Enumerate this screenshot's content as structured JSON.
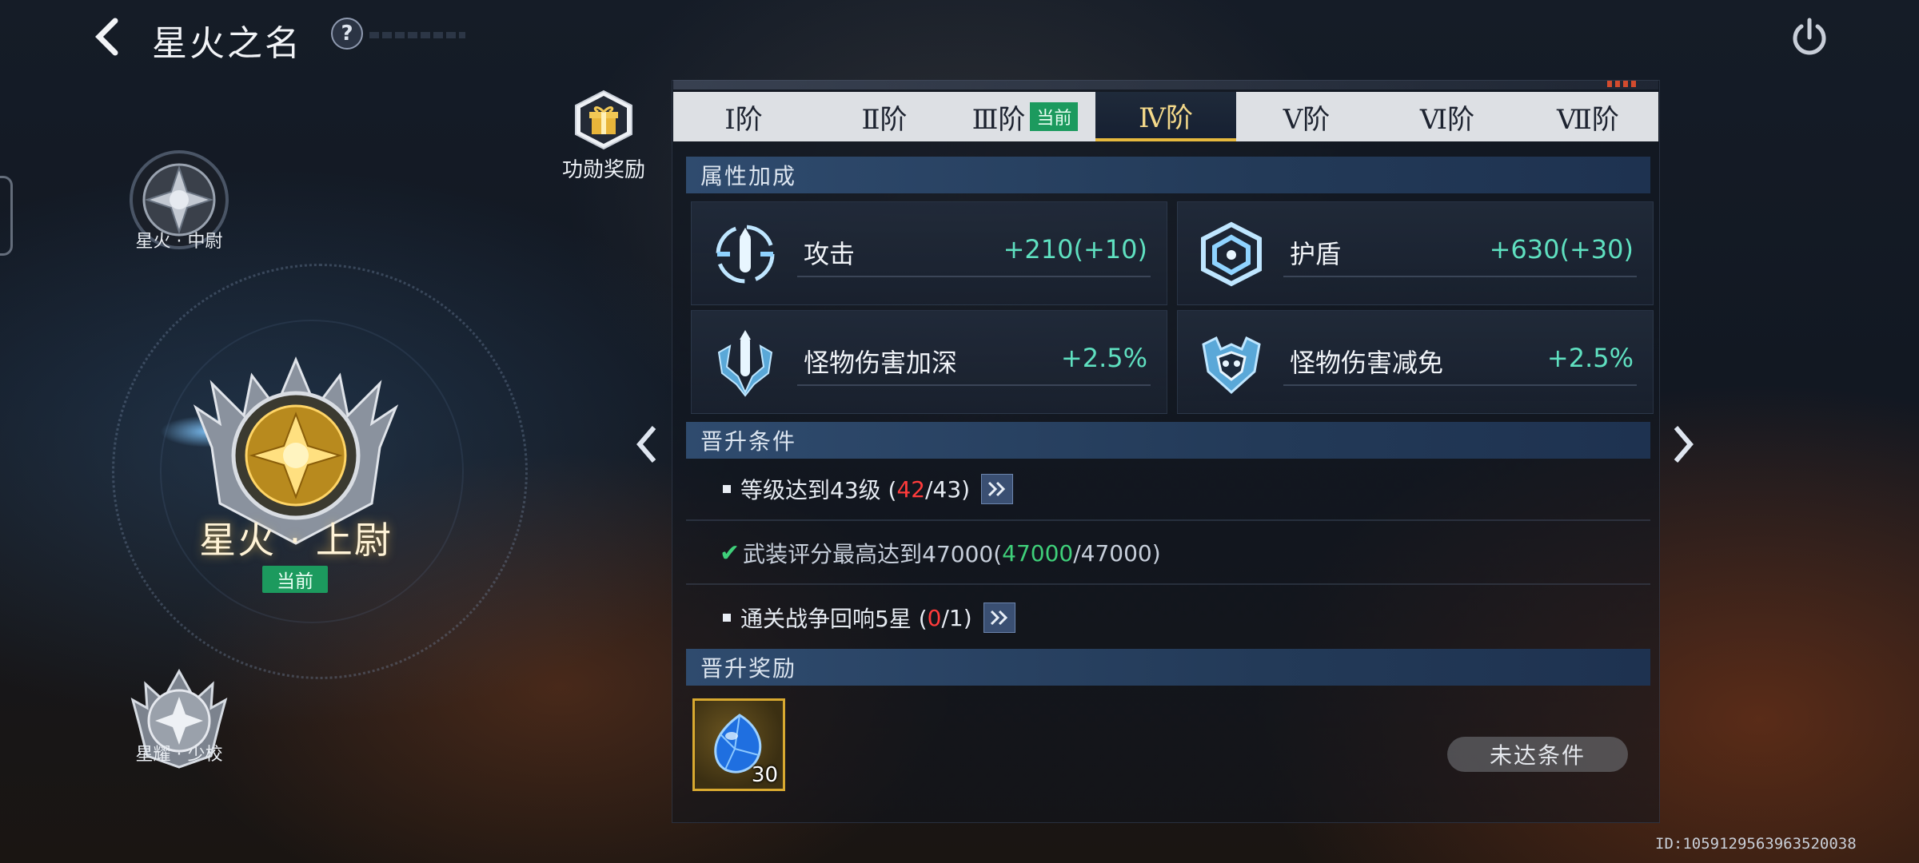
{
  "header": {
    "title": "星火之名",
    "help_label": "?"
  },
  "ranks": {
    "upper": {
      "label": "星火 · 中尉"
    },
    "current": {
      "label": "星火 · 上尉",
      "badge": "当前"
    },
    "lower": {
      "label": "星耀 · 少校"
    }
  },
  "medal_reward": {
    "label": "功勋奖励",
    "icon": "gift-box-icon"
  },
  "tabs": [
    {
      "label": "Ⅰ阶"
    },
    {
      "label": "Ⅱ阶"
    },
    {
      "label": "Ⅲ阶",
      "badge": "当前"
    },
    {
      "label": "Ⅳ阶",
      "active": true
    },
    {
      "label": "Ⅴ阶"
    },
    {
      "label": "Ⅵ阶"
    },
    {
      "label": "Ⅶ阶"
    }
  ],
  "attributes": {
    "header": "属性加成",
    "items": [
      {
        "name": "攻击",
        "value": "+210(+10)",
        "icon": "attack-bullet-icon"
      },
      {
        "name": "护盾",
        "value": "+630(+30)",
        "icon": "shield-hex-icon"
      },
      {
        "name": "怪物伤害加深",
        "value": "+2.5%",
        "icon": "monster-damage-icon"
      },
      {
        "name": "怪物伤害减免",
        "value": "+2.5%",
        "icon": "monster-defense-icon"
      }
    ]
  },
  "conditions": {
    "header": "晋升条件",
    "level": {
      "text": "等级达到43级 (",
      "current": "42",
      "sep_total": "/43)"
    },
    "gear": {
      "text": "武装评分最高达到47000(",
      "current": "47000",
      "sep_total": "/47000)"
    },
    "war": {
      "text": "通关战争回响5星 (",
      "current": "0",
      "sep_total": "/1)"
    }
  },
  "rewards": {
    "header": "晋升奖励",
    "item": {
      "count": "30",
      "icon": "blue-gem-icon"
    },
    "status_button": "未达条件"
  },
  "footer": {
    "id": "ID:1059129563963520038"
  },
  "colors": {
    "accent_gold": "#e6b93e",
    "current_badge": "#1c9a5e",
    "value_teal": "#5fe0c0",
    "progress_red": "#ff3b3b",
    "progress_green": "#3fd07a"
  }
}
